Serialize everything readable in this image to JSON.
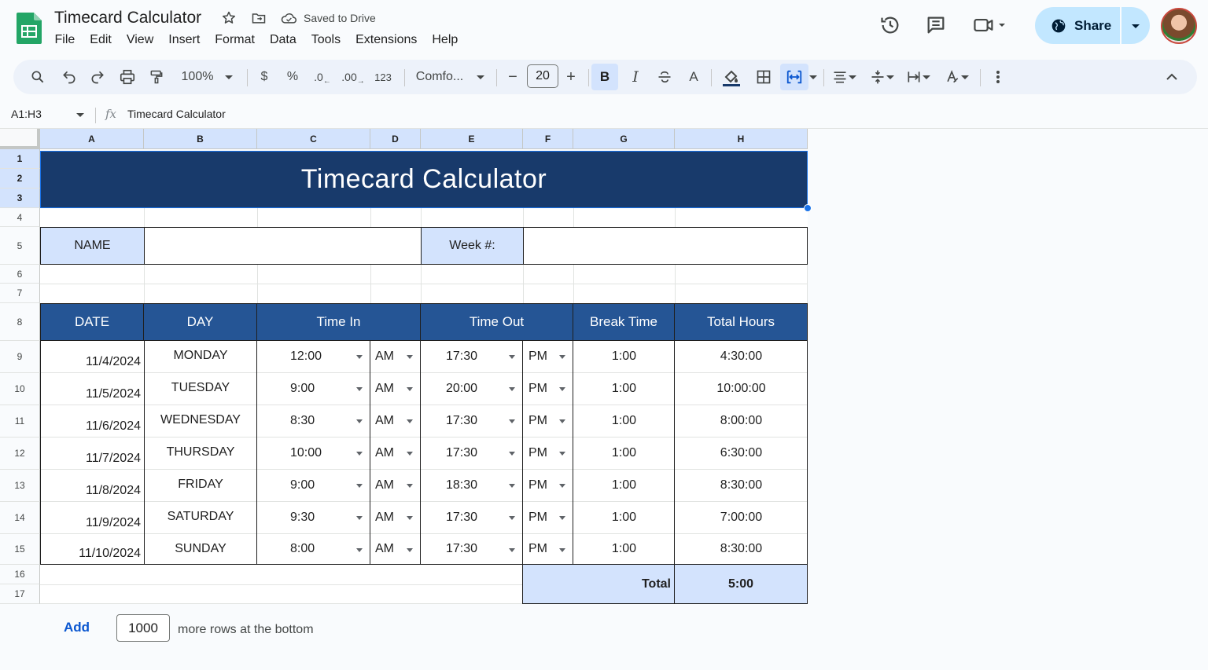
{
  "header": {
    "doc_title": "Timecard Calculator",
    "saved_status": "Saved to Drive",
    "menu": [
      "File",
      "Edit",
      "View",
      "Insert",
      "Format",
      "Data",
      "Tools",
      "Extensions",
      "Help"
    ],
    "share_label": "Share"
  },
  "toolbar": {
    "zoom": "100%",
    "currency": "$",
    "percent": "%",
    "dec_decrease": ".0",
    "dec_increase": ".00",
    "number_format": "123",
    "font": "Comfo...",
    "font_size": "20",
    "minus": "−",
    "plus": "+",
    "bold": "B",
    "italic": "I",
    "text_color": "A"
  },
  "formula_bar": {
    "name_box": "A1:H3",
    "fx": "fx",
    "content": "Timecard Calculator"
  },
  "grid": {
    "columns": [
      "A",
      "B",
      "C",
      "D",
      "E",
      "F",
      "G",
      "H"
    ],
    "rows": [
      "1",
      "2",
      "3",
      "4",
      "5",
      "6",
      "7",
      "8",
      "9",
      "10",
      "11",
      "12",
      "13",
      "14",
      "15",
      "16",
      "17"
    ],
    "banner": "Timecard Calculator",
    "name_label": "NAME",
    "week_label": "Week #:",
    "headers": {
      "date": "DATE",
      "day": "DAY",
      "time_in": "Time In",
      "time_out": "Time Out",
      "break_time": "Break Time",
      "total_hours": "Total Hours"
    },
    "entries": [
      {
        "date": "11/4/2024",
        "day": "MONDAY",
        "time_in": "12:00",
        "in_ampm": "AM",
        "time_out": "17:30",
        "out_ampm": "PM",
        "break": "1:00",
        "total": "4:30:00"
      },
      {
        "date": "11/5/2024",
        "day": "TUESDAY",
        "time_in": "9:00",
        "in_ampm": "AM",
        "time_out": "20:00",
        "out_ampm": "PM",
        "break": "1:00",
        "total": "10:00:00"
      },
      {
        "date": "11/6/2024",
        "day": "WEDNESDAY",
        "time_in": "8:30",
        "in_ampm": "AM",
        "time_out": "17:30",
        "out_ampm": "PM",
        "break": "1:00",
        "total": "8:00:00"
      },
      {
        "date": "11/7/2024",
        "day": "THURSDAY",
        "time_in": "10:00",
        "in_ampm": "AM",
        "time_out": "17:30",
        "out_ampm": "PM",
        "break": "1:00",
        "total": "6:30:00"
      },
      {
        "date": "11/8/2024",
        "day": "FRIDAY",
        "time_in": "9:00",
        "in_ampm": "AM",
        "time_out": "18:30",
        "out_ampm": "PM",
        "break": "1:00",
        "total": "8:30:00"
      },
      {
        "date": "11/9/2024",
        "day": "SATURDAY",
        "time_in": "9:30",
        "in_ampm": "AM",
        "time_out": "17:30",
        "out_ampm": "PM",
        "break": "1:00",
        "total": "7:00:00"
      },
      {
        "date": "11/10/2024",
        "day": "SUNDAY",
        "time_in": "8:00",
        "in_ampm": "AM",
        "time_out": "17:30",
        "out_ampm": "PM",
        "break": "1:00",
        "total": "8:30:00"
      }
    ],
    "total_label": "Total",
    "total_value": "5:00"
  },
  "footer": {
    "add_label": "Add",
    "rows_count": "1000",
    "suffix": "more rows at the bottom"
  },
  "colors": {
    "banner": "#183a6b",
    "header_row": "#255595",
    "label_fill": "#d3e3fd",
    "share_button": "#c2e7ff",
    "selection": "#1a73e8"
  }
}
